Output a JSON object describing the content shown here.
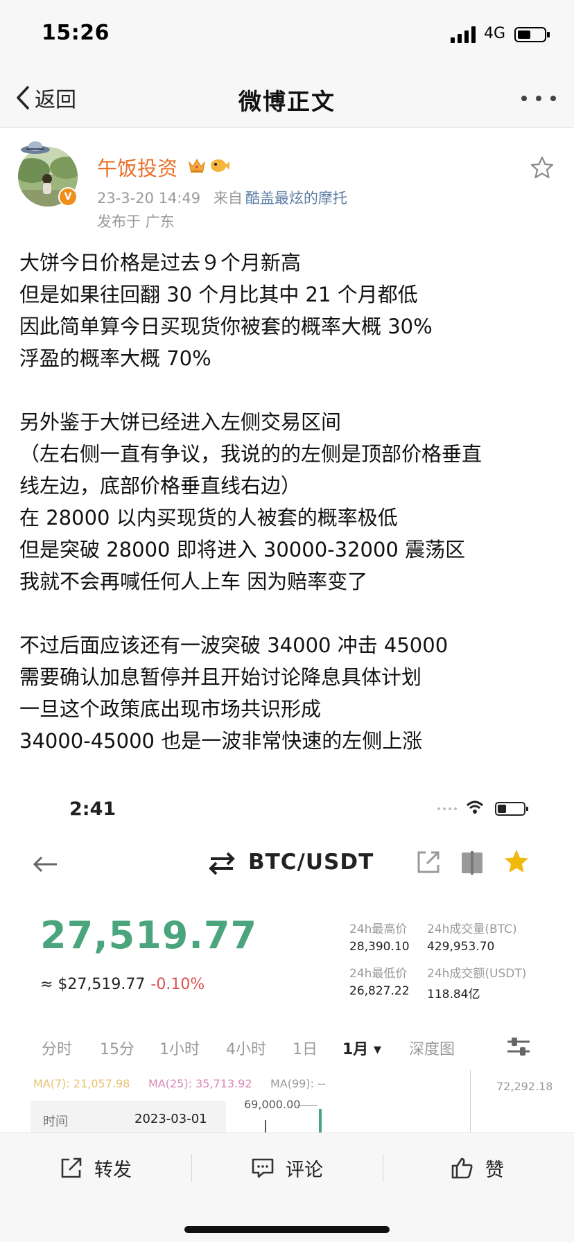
{
  "status_bar": {
    "time": "15:26",
    "network": "4G"
  },
  "nav": {
    "back_label": "返回",
    "title": "微博正文"
  },
  "post": {
    "author": "午饭投资",
    "timestamp": "23-3-20 14:49",
    "source_prefix": "来自",
    "source": "酷盖最炫的摩托",
    "location": "发布于 广东",
    "lines": [
      "大饼今日价格是过去９个月新高",
      "但是如果往回翻 30 个月比其中 21 个月都低",
      "因此简单算今日买现货你被套的概率大概 30%",
      "浮盈的概率大概 70%",
      "",
      "另外鉴于大饼已经进入左侧交易区间",
      "（左右侧一直有争议，我说的的左侧是顶部价格垂直",
      "线左边，底部价格垂直线右边）",
      "在 28000 以内买现货的人被套的概率极低",
      "但是突破 28000 即将进入 30000-32000 震荡区",
      "我就不会再喊任何人上车 因为赔率变了",
      "",
      "不过后面应该还有一波突破 34000 冲击 45000",
      "需要确认加息暂停并且开始讨论降息具体计划",
      "一旦这个政策底出现市场共识形成",
      "34000-45000 也是一波非常快速的左侧上涨"
    ]
  },
  "embed": {
    "time": "2:41",
    "pair": "BTC/USDT",
    "price": "27,519.77",
    "fiat": "≈ $27,519.77",
    "change": "-0.10%",
    "stats": {
      "high_label": "24h最高价",
      "high": "28,390.10",
      "vol_btc_label": "24h成交量(BTC)",
      "vol_btc": "429,953.70",
      "low_label": "24h最低价",
      "low": "26,827.22",
      "vol_usdt_label": "24h成交额(USDT)",
      "vol_usdt": "118.84亿"
    },
    "tabs": [
      "分时",
      "15分",
      "1小时",
      "4小时",
      "1日",
      "1月 ▾",
      "深度图"
    ],
    "active_tab": "1月 ▾",
    "ma": {
      "ma7": "MA(7): 21,057.98",
      "ma25": "MA(25): 35,713.92",
      "ma99": "MA(99): --"
    },
    "axis_max": "72,292.18",
    "level": "69,000.00",
    "panel": {
      "key": "时间",
      "value": "2023-03-01"
    },
    "colors": {
      "price_green": "#4aa47c",
      "change_red": "#d9534f",
      "fav_star": "#f0b90b"
    }
  },
  "actions": {
    "repost": "转发",
    "comment": "评论",
    "like": "赞"
  },
  "colors": {
    "username": "#e8702a",
    "source_link": "#5d7da6",
    "meta": "#999999"
  }
}
